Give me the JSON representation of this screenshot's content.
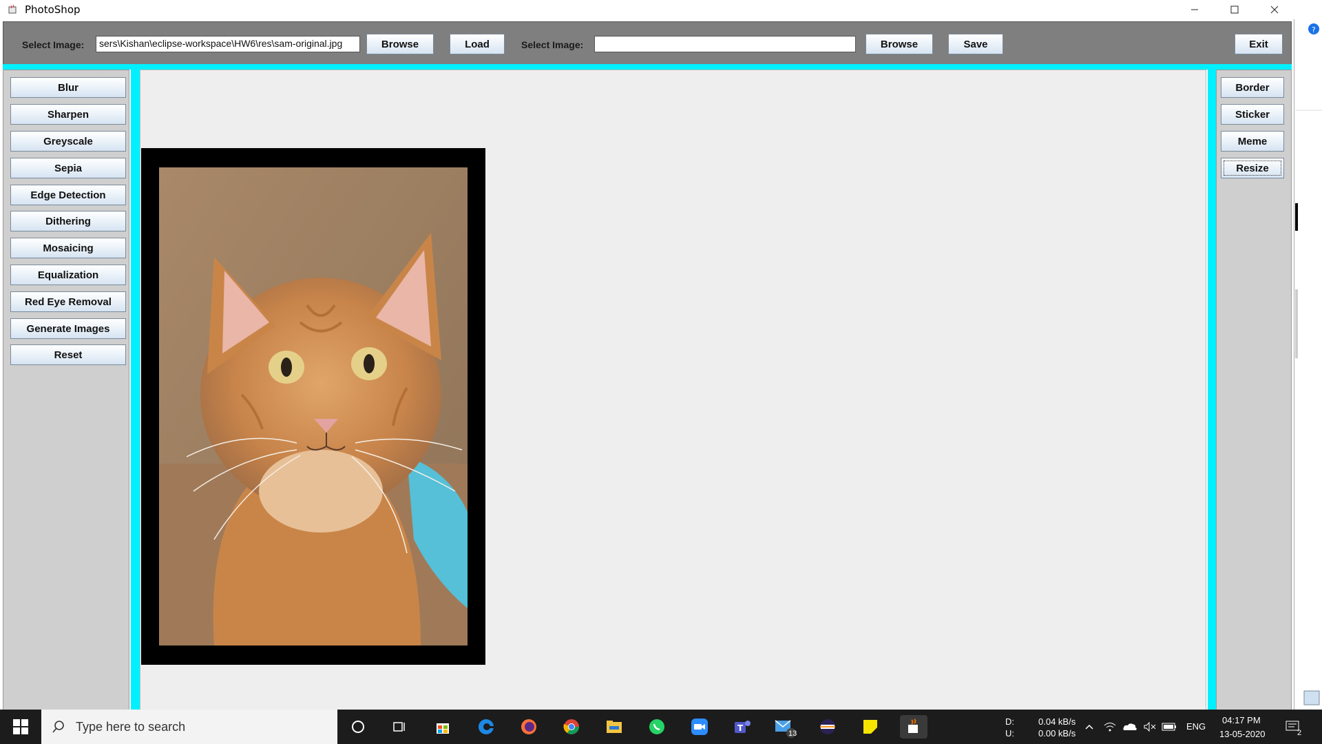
{
  "window": {
    "title": "PhotoShop"
  },
  "toolbar": {
    "select_image_label_1": "Select Image:",
    "path_value": "sers\\Kishan\\eclipse-workspace\\HW6\\res\\sam-original.jpg",
    "browse_1": "Browse",
    "load": "Load",
    "select_image_label_2": "Select Image:",
    "save_path_value": "",
    "browse_2": "Browse",
    "save": "Save",
    "exit": "Exit"
  },
  "left_panel": {
    "buttons": [
      "Blur",
      "Sharpen",
      "Greyscale",
      "Sepia",
      "Edge Detection",
      "Dithering",
      "Mosaicing",
      "Equalization",
      "Red Eye Removal",
      "Generate Images",
      "Reset"
    ]
  },
  "right_panel": {
    "buttons": [
      "Border",
      "Sticker",
      "Meme",
      "Resize"
    ]
  },
  "taskbar": {
    "search_placeholder": "Type here to search",
    "net_d_label": "D:",
    "net_u_label": "U:",
    "net_d_value": "0.04 kB/s",
    "net_u_value": "0.00 kB/s",
    "lang": "ENG",
    "time": "04:17 PM",
    "date": "13-05-2020",
    "mail_badge": "13",
    "notif_badge": "2"
  },
  "colors": {
    "accent_cyan": "#00f0ff",
    "toolbar_gray": "#7f7f7f",
    "panel_gray": "#cfcfcf"
  }
}
